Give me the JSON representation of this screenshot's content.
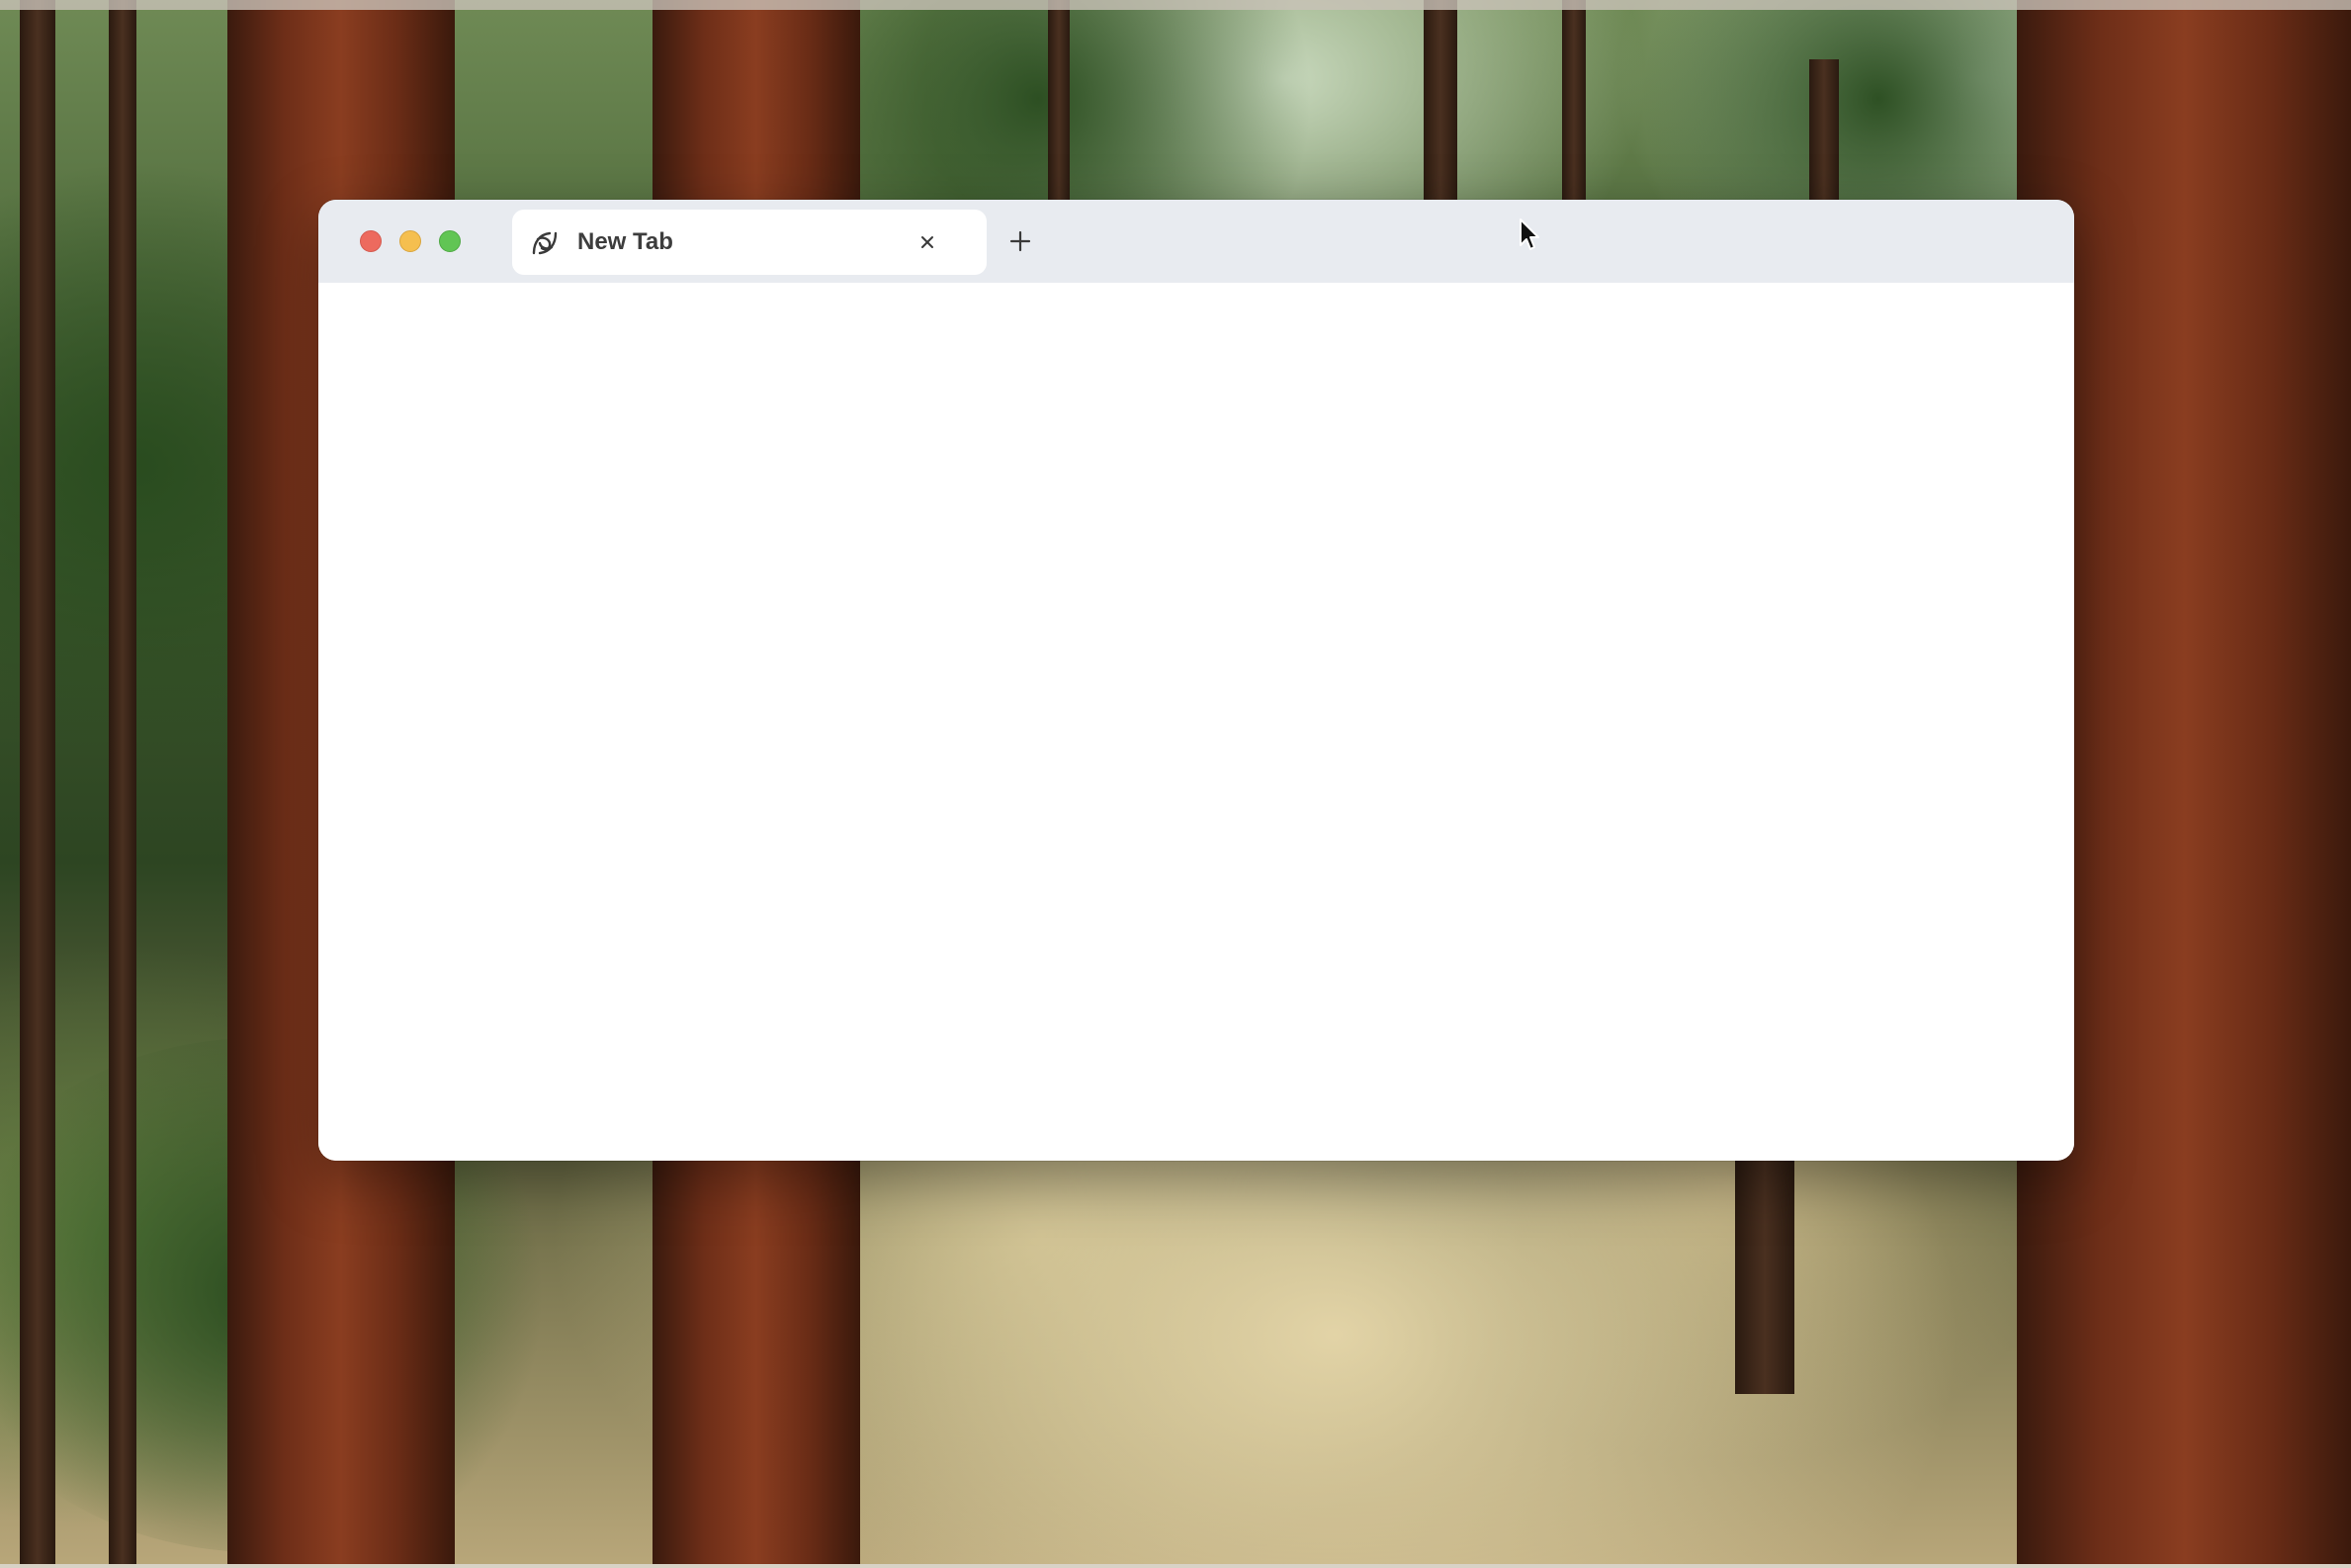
{
  "desktop": {
    "wallpaper": "forest-sequoia"
  },
  "browser": {
    "traffic_lights": {
      "close_color": "#ed6a5e",
      "minimize_color": "#f5bf4f",
      "zoom_color": "#61c554"
    },
    "tabs": [
      {
        "title": "New Tab",
        "icon": "browser-logo-icon",
        "active": true
      }
    ],
    "new_tab_icon": "plus-icon",
    "tab_bar_color": "#e8ebf0",
    "content_color": "#ffffff"
  },
  "cursor": {
    "icon": "arrow-cursor-icon"
  }
}
